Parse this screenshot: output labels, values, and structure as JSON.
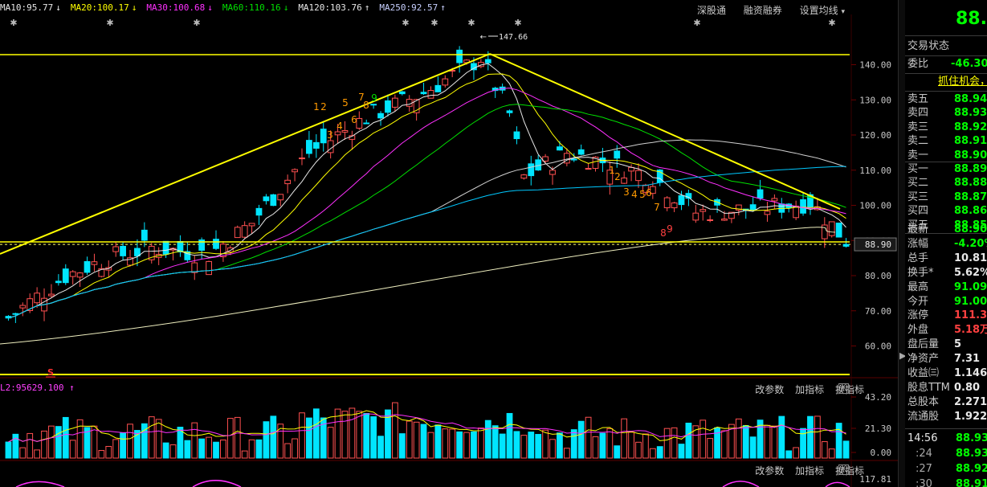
{
  "ma_legend": [
    {
      "text": "MA10:95.77",
      "arrow": "↓",
      "color": "#e8e8e8",
      "arrow_color": "#e8e8e8"
    },
    {
      "text": "MA20:100.17",
      "arrow": "↓",
      "color": "#ffff00",
      "arrow_color": "#ffff00"
    },
    {
      "text": "MA30:100.68",
      "arrow": "↓",
      "color": "#ff30ff",
      "arrow_color": "#ff30ff"
    },
    {
      "text": "MA60:110.16",
      "arrow": "↓",
      "color": "#00e000",
      "arrow_color": "#00e000"
    },
    {
      "text": "MA120:103.76",
      "arrow": "↑",
      "color": "#e8e8e8",
      "arrow_color": "#e8e8e8"
    },
    {
      "text": "MA250:92.57",
      "arrow": "↑",
      "color": "#c8d0ff",
      "arrow_color": "#c8d0ff"
    }
  ],
  "top_links": [
    "深股通",
    "融资融券",
    "设置均线"
  ],
  "price_axis": {
    "labels": [
      "140.00",
      "130.00",
      "120.00",
      "110.00",
      "100.00",
      "90.00",
      "80.00",
      "70.00",
      "60.00"
    ],
    "current": "88.90"
  },
  "high_annotation": "147.66",
  "volume_panel": {
    "label": "L2:95629.100",
    "arrow": "↑",
    "axis_labels": [
      "43.20",
      "21.30",
      "0.00"
    ],
    "links": [
      "改参数",
      "加指标",
      "换指标"
    ],
    "close": "X"
  },
  "indicator_panel": {
    "axis_labels": [
      "117.81"
    ],
    "links": [
      "改参数",
      "加指标",
      "换指标"
    ],
    "close": "X"
  },
  "flag_symbol": "S",
  "count_labels": [
    "1",
    "2",
    "3",
    "4",
    "5",
    "6",
    "7",
    "8",
    "9",
    "1",
    "2",
    "3",
    "4",
    "5",
    "6",
    "7",
    "8",
    "9"
  ],
  "right_panel": {
    "price": "88.90",
    "status_label": "交易状态",
    "weibi_label": "委比",
    "weibi_value": "-46.30%",
    "banner": "抓住机会，",
    "sell": [
      {
        "label": "卖五",
        "price": "88.94"
      },
      {
        "label": "卖四",
        "price": "88.93"
      },
      {
        "label": "卖三",
        "price": "88.92"
      },
      {
        "label": "卖二",
        "price": "88.91"
      },
      {
        "label": "卖一",
        "price": "88.90"
      }
    ],
    "buy": [
      {
        "label": "买一",
        "price": "88.89"
      },
      {
        "label": "买二",
        "price": "88.88"
      },
      {
        "label": "买三",
        "price": "88.87"
      },
      {
        "label": "买四",
        "price": "88.86"
      },
      {
        "label": "买五",
        "price": "88.85"
      }
    ],
    "stats": [
      {
        "label": "最新",
        "value": "88.90",
        "color": "#00ff00"
      },
      {
        "label": "涨幅",
        "value": "-4.20%",
        "color": "#00ff00"
      },
      {
        "label": "总手",
        "value": "10.81万",
        "color": "#e8e8e8"
      },
      {
        "label": "换手*",
        "value": "5.62%",
        "color": "#e8e8e8"
      },
      {
        "label": "最高",
        "value": "91.09",
        "color": "#00ff00"
      },
      {
        "label": "今开",
        "value": "91.00",
        "color": "#00ff00"
      },
      {
        "label": "涨停",
        "value": "111.36",
        "color": "#ff4040"
      },
      {
        "label": "外盘",
        "value": "5.18万",
        "color": "#ff4040"
      },
      {
        "label": "盘后量",
        "value": "5",
        "color": "#e8e8e8"
      },
      {
        "label": "净资产",
        "value": "7.31",
        "color": "#e8e8e8"
      },
      {
        "label": "收益㈢",
        "value": "1.146",
        "color": "#e8e8e8"
      },
      {
        "label": "股息TTM",
        "value": "0.80",
        "color": "#e8e8e8"
      },
      {
        "label": "总股本",
        "value": "2.271亿",
        "color": "#e8e8e8"
      },
      {
        "label": "流通股",
        "value": "1.922亿",
        "color": "#e8e8e8"
      }
    ],
    "ticks": [
      {
        "time": "14:56",
        "price": "88.93"
      },
      {
        "time": ":24",
        "price": "88.93"
      },
      {
        "time": ":27",
        "price": "88.92"
      },
      {
        "time": ":30",
        "price": "88.91"
      }
    ]
  },
  "colors": {
    "up": "#ff5050",
    "down": "#00e5ff",
    "trend": "#ffff00",
    "bg": "#000000"
  }
}
